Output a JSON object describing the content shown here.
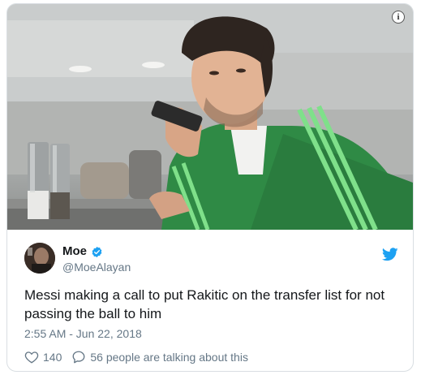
{
  "tweet": {
    "display_name": "Moe",
    "handle": "@MoeAlayan",
    "verified": true,
    "text": "Messi making a call to put Rakitic on the transfer list for not passing the ball to him",
    "timestamp": "2:55 AM - Jun 22, 2018",
    "likes": "140",
    "replies_label": "56 people are talking about this"
  },
  "media": {
    "info_glyph": "i"
  },
  "icons": {
    "info": "info-icon",
    "verified": "verified-badge-icon",
    "brand": "twitter-bird-icon",
    "like": "heart-icon",
    "reply": "speech-bubble-icon"
  },
  "colors": {
    "brand_blue": "#1da1f2",
    "secondary_text": "#657786",
    "primary_text": "#14171a",
    "jacket_green": "#2f8a45",
    "stripe_green": "#7fe08a"
  }
}
